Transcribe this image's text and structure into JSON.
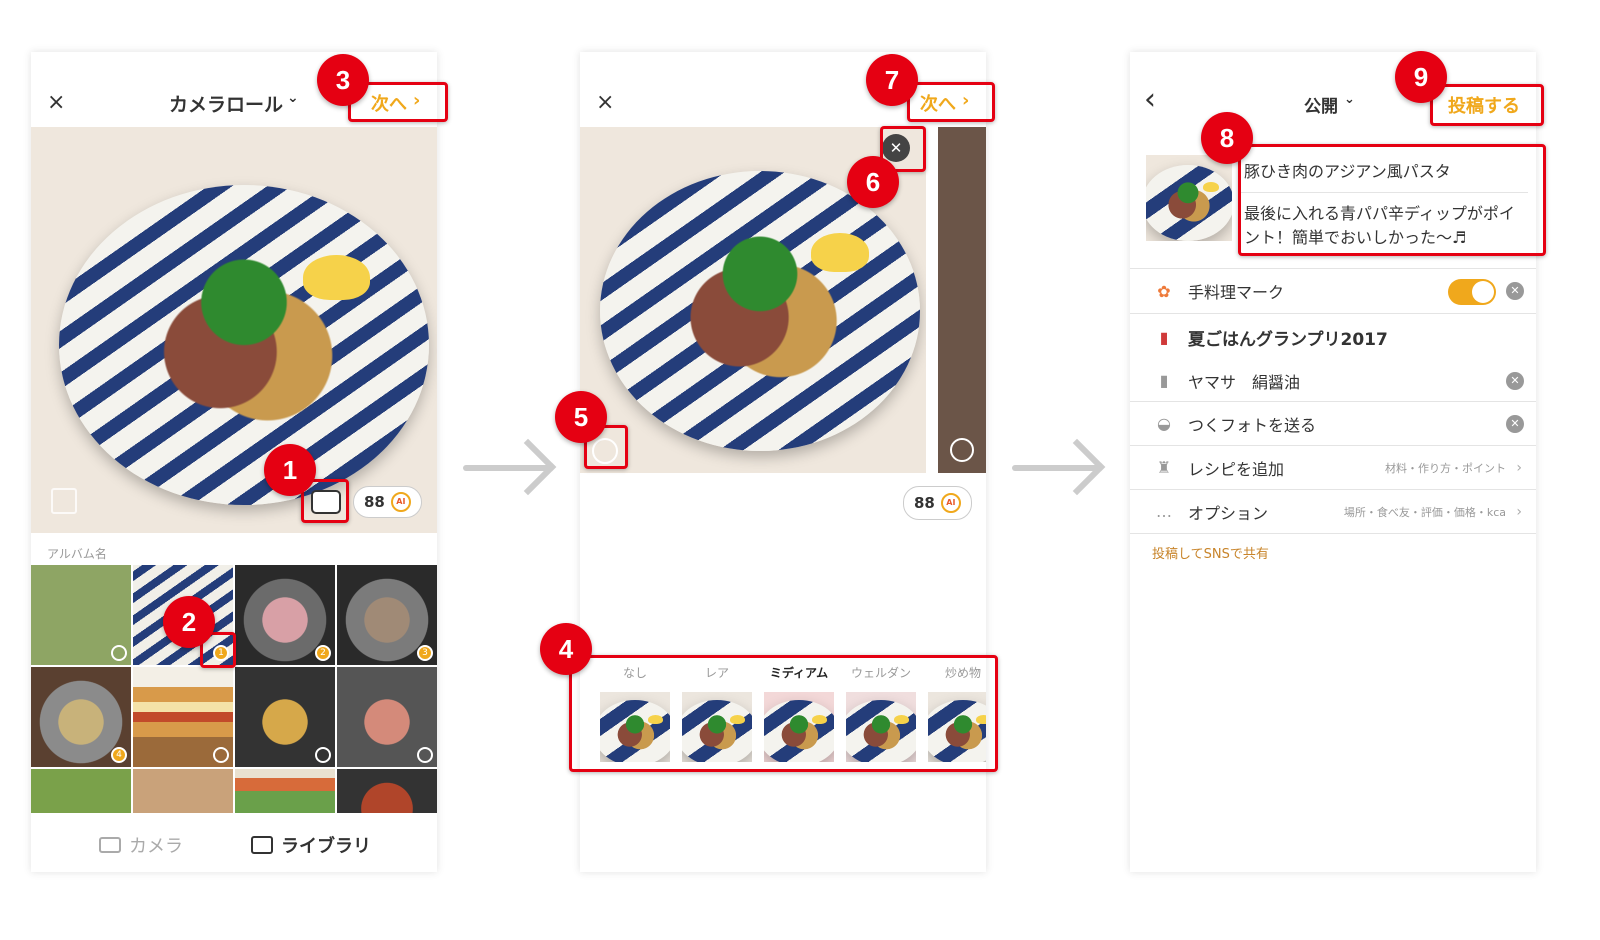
{
  "screen1": {
    "close_icon": "×",
    "title": "カメラロール",
    "title_chevron": "⌄",
    "next_label": "次へ",
    "next_chevron": "›",
    "ai_count": "88",
    "ai_badge": "AI",
    "album_label": "アルバム名",
    "thumb_badges": [
      "",
      "1",
      "2",
      "3",
      "4",
      "",
      "",
      "",
      "",
      "",
      "",
      ""
    ],
    "tabs": [
      {
        "icon": "camera-icon",
        "label": "カメラ"
      },
      {
        "icon": "image-icon",
        "label": "ライブラリ"
      }
    ]
  },
  "screen2": {
    "close_icon": "×",
    "next_label": "次へ",
    "next_chevron": "›",
    "remove_icon": "✕",
    "ai_count": "88",
    "ai_badge": "AI",
    "filters": [
      "なし",
      "レア",
      "ミディアム",
      "ウェルダン",
      "炒め物"
    ],
    "current_filter_index": 2
  },
  "screen3": {
    "back_icon": "‹",
    "visibility_label": "公開",
    "visibility_chevron": "⌄",
    "post_label": "投稿する",
    "recipe_title": "豚ひき肉のアジアン風パスタ",
    "description": "最後に入れる青パパ辛ディップがポイント！簡単でおいしかった〜♬",
    "rows": [
      {
        "icon": "flower-icon",
        "label": "手料理マーク",
        "sub": ""
      },
      {
        "icon": "cup-icon",
        "label": "夏ごはんグランプリ2017",
        "sub": ""
      },
      {
        "icon": "bottle-icon",
        "label": "ヤマサ　絹醤油",
        "sub": ""
      },
      {
        "icon": "dish-icon",
        "label": "つくフォトを送る",
        "sub": ""
      },
      {
        "icon": "chef-hat-icon",
        "label": "レシピを追加",
        "sub": "材料・作り方・ポイント"
      },
      {
        "icon": "more-icon",
        "label": "オプション",
        "sub": "場所・食べ友・評価・価格・kca"
      }
    ],
    "share_label": "投稿してSNSで共有",
    "toggle_on": true
  },
  "callouts": [
    "1",
    "2",
    "3",
    "4",
    "5",
    "6",
    "7",
    "8",
    "9"
  ],
  "colors": {
    "accent": "#f0a81c",
    "callout": "#e50012",
    "share": "#c8842a"
  }
}
